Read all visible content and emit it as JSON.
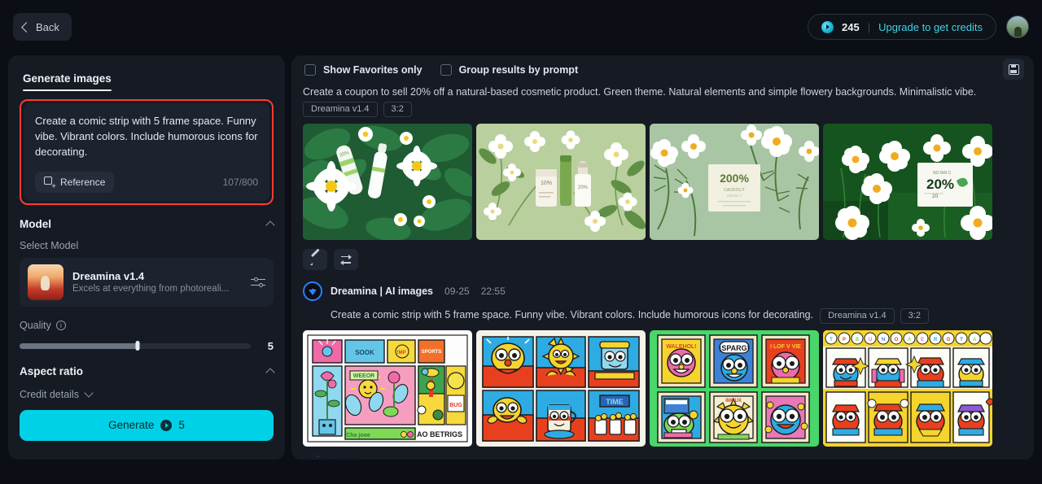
{
  "topbar": {
    "back_label": "Back",
    "credits_value": "245",
    "credits_separator": "|",
    "upgrade_label": "Upgrade to get credits"
  },
  "left_panel": {
    "tab_label": "Generate images",
    "prompt": {
      "text": "Create a comic strip with 5 frame space. Funny vibe. Vibrant colors. Include humorous icons for decorating.",
      "reference_label": "Reference",
      "char_count": "107/800",
      "highlight_color": "#ff3b30"
    },
    "model_section": {
      "title": "Model",
      "select_label": "Select Model",
      "model_name": "Dreamina v1.4",
      "model_desc": "Excels at everything from photoreali..."
    },
    "quality": {
      "label": "Quality",
      "value": "5",
      "fill_percent": 51
    },
    "aspect_ratio": {
      "title": "Aspect ratio"
    },
    "credit_details_label": "Credit details",
    "generate": {
      "label": "Generate",
      "cost": "5",
      "color": "#00d1e6"
    }
  },
  "right_panel": {
    "toolbar": {
      "favorites_label": "Show Favorites only",
      "favorites_checked": false,
      "group_label": "Group results by prompt",
      "group_checked": false
    },
    "results": [
      {
        "prompt": "Create a coupon to sell 20% off a natural-based cosmetic product. Green theme. Natural elements and simple flowery backgrounds. Minimalistic vibe.",
        "tags": [
          "Dreamina v1.4",
          "3:2"
        ],
        "images": [
          "green-leaves-daisies-cosmetic-tubes",
          "light-green-jasmine-serum-bottles",
          "sage-green-200-percent-coupon-box",
          "dark-green-20-percent-product-card"
        ]
      },
      {
        "title": "Dreamina | AI images",
        "date": "09-25",
        "time": "22:55",
        "prompt": "Create a comic strip with 5 frame space. Funny vibe. Vibrant colors. Include humorous icons for decorating.",
        "tags": [
          "Dreamina v1.4",
          "3:2"
        ],
        "images": [
          "pastel-comic-strip-flowers-sun",
          "blue-red-six-panel-cartoon-faces",
          "green-background-six-panel-characters",
          "yellow-blue-red-robot-mascots"
        ]
      }
    ]
  }
}
